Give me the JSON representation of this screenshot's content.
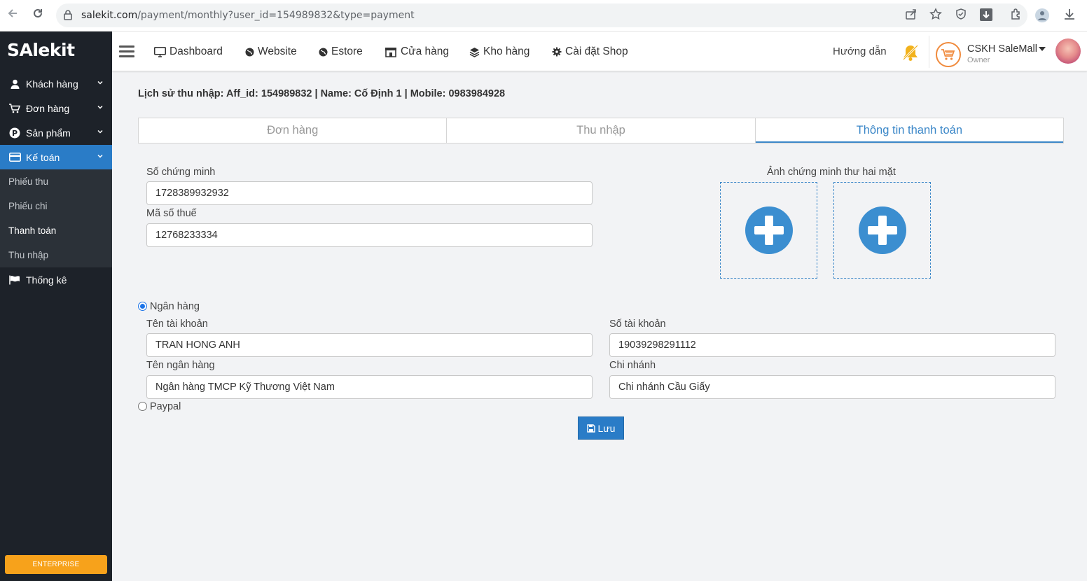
{
  "browser": {
    "url_host": "salekit.com",
    "url_path": "/payment/monthly?user_id=154989832&type=payment"
  },
  "sidebar": {
    "logo": "SAlekit",
    "items": [
      {
        "label": "Khách hàng",
        "icon": "user-icon"
      },
      {
        "label": "Đơn hàng",
        "icon": "cart-icon"
      },
      {
        "label": "Sản phẩm",
        "icon": "product-icon"
      },
      {
        "label": "Kế toán",
        "icon": "credit-card-icon"
      },
      {
        "label": "Thống kê",
        "icon": "flag-icon"
      }
    ],
    "subitems": [
      "Phiếu thu",
      "Phiếu chi",
      "Thanh toán",
      "Thu nhập"
    ],
    "badge": "ENTERPRISE"
  },
  "topnav": {
    "links": [
      "Dashboard",
      "Website",
      "Estore",
      "Cửa hàng",
      "Kho hàng",
      "Cài đặt Shop"
    ],
    "guide": "Hướng dẫn",
    "user_name": "CSKH SaleMall",
    "user_role": "Owner"
  },
  "content": {
    "heading": "Lịch sử thu nhập: Aff_id: 154989832 | Name: Cố Định 1 | Mobile: 0983984928",
    "tabs": [
      "Đơn hàng",
      "Thu nhập",
      "Thông tin thanh toán"
    ],
    "id_label": "Số chứng minh",
    "id_value": "1728389932932",
    "tax_label": "Mã số thuế",
    "tax_value": "12768233334",
    "photo_label": "Ảnh chứng minh thư hai mặt",
    "bank_radio": "Ngân hàng",
    "account_name_label": "Tên tài khoản",
    "account_name_value": "TRAN HONG ANH",
    "account_number_label": "Số tài khoản",
    "account_number_value": "19039298291112",
    "bank_name_label": "Tên ngân hàng",
    "bank_name_value": "Ngân hàng TMCP Kỹ Thương Việt Nam",
    "branch_label": "Chi nhánh",
    "branch_value": "Chi nhánh Cầu Giấy",
    "paypal_radio": "Paypal",
    "save_label": "Lưu"
  },
  "colors": {
    "sidebar_bg": "#1d2229",
    "accent": "#2a7cc7",
    "tab_active": "#3b87c8",
    "enterprise": "#f7a21b"
  }
}
